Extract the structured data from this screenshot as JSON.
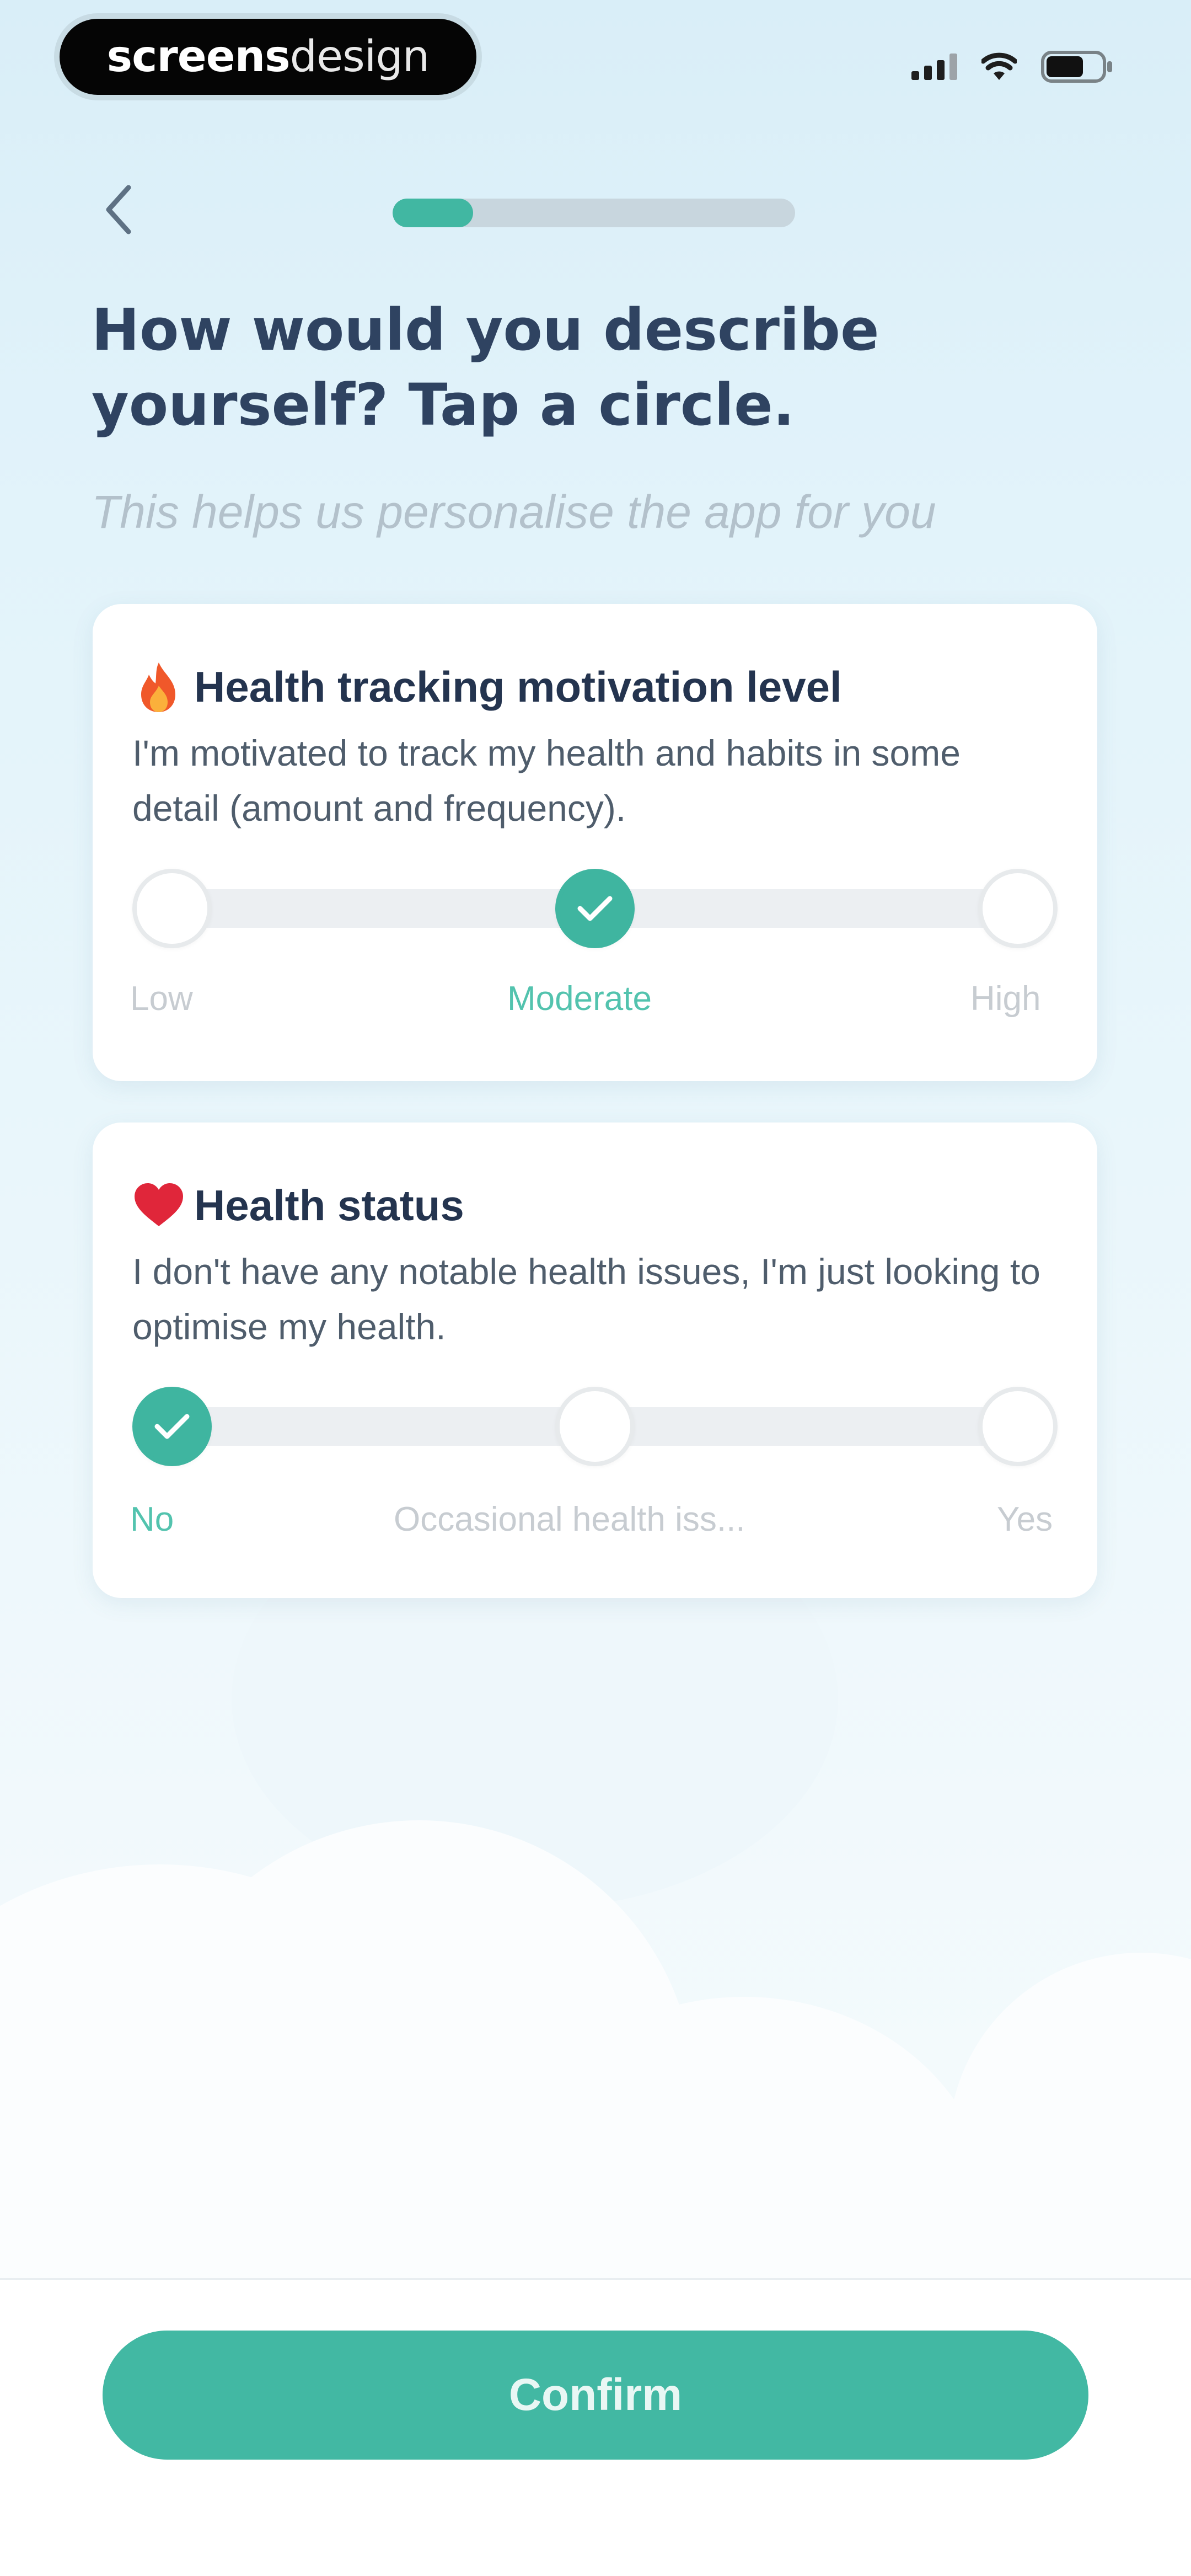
{
  "status_bar": {
    "brand_part1": "screens",
    "brand_part2": "design",
    "signal_icon": "cellular-signal-icon",
    "wifi_icon": "wifi-icon",
    "battery_icon": "battery-icon"
  },
  "header": {
    "back_icon": "chevron-left-icon",
    "progress_fraction": 0.2
  },
  "main": {
    "title": "How would you describe yourself? Tap a circle.",
    "subtitle": "This helps us personalise the app for you"
  },
  "cards": [
    {
      "icon": "fire-emoji-icon",
      "title": "Health tracking motivation level",
      "description": "I'm motivated to track my health and habits in some detail (amount and frequency).",
      "options": [
        "Low",
        "Moderate",
        "High"
      ],
      "selected_index": 1
    },
    {
      "icon": "red-heart-emoji-icon",
      "title": "Health status",
      "description": "I don't have any notable health issues, I'm just looking to optimise my health.",
      "options": [
        "No",
        "Occasional health iss...",
        "Yes"
      ],
      "selected_index": 0
    }
  ],
  "footer": {
    "confirm_label": "Confirm"
  },
  "colors": {
    "accent": "#41b7a2",
    "title": "#2f4361",
    "subtitle": "#b3c1cb",
    "background_top": "#d9eef8"
  }
}
